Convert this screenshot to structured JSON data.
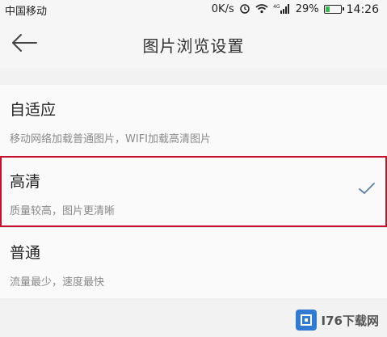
{
  "status_bar": {
    "carrier": "中国移动",
    "net_speed": "0K/s",
    "signal": "4G",
    "battery_percent": "29%",
    "battery_level": 0.29,
    "time": "14:26"
  },
  "header": {
    "title": "图片浏览设置",
    "back_icon": "back-arrow-icon"
  },
  "options": [
    {
      "title": "自适应",
      "desc": "移动网络加载普通图片，WIFI加载高清图片",
      "selected": false
    },
    {
      "title": "高清",
      "desc": "质量较高，图片更清晰",
      "selected": true
    },
    {
      "title": "普通",
      "desc": "流量最少，速度最快",
      "selected": false
    }
  ],
  "watermark": {
    "logo_text": "I76下载网"
  },
  "colors": {
    "highlight": "#c8102e",
    "check": "#5b7fa6",
    "background": "#f2f2f2"
  }
}
